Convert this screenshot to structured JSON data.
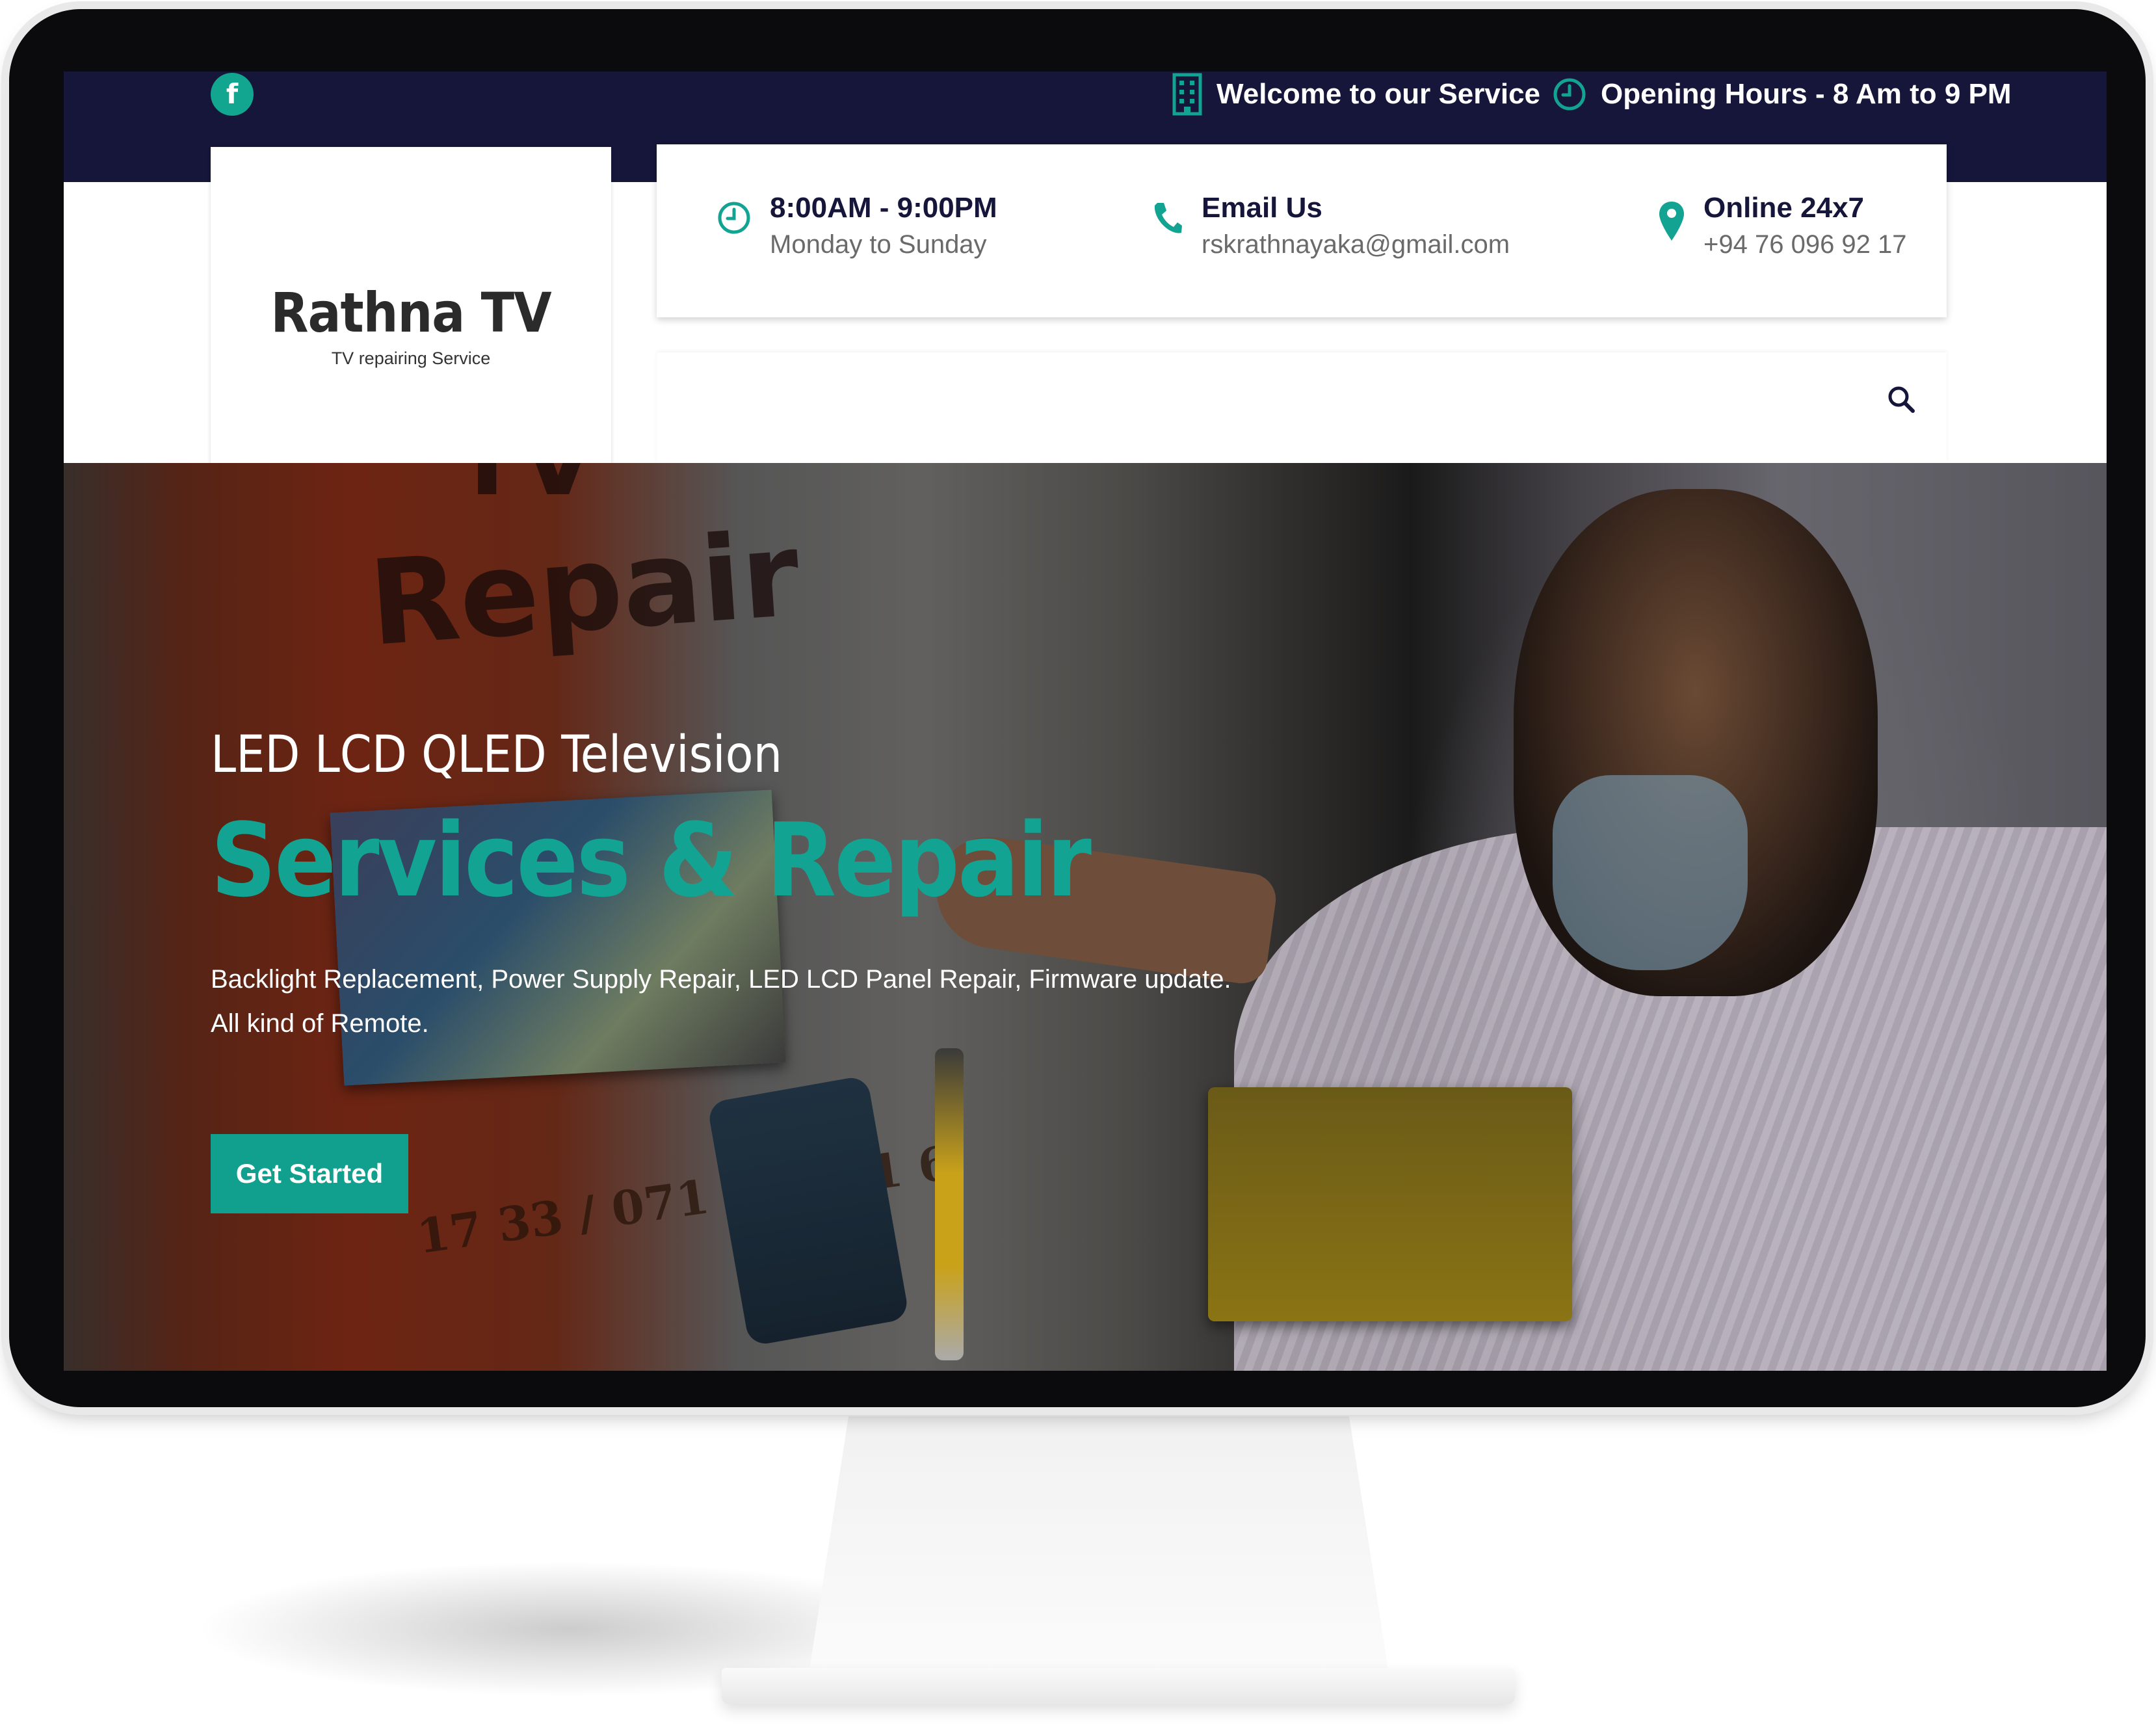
{
  "topbar": {
    "facebook_icon": "f",
    "welcome_text": "Welcome to our Service",
    "hours_text": "Opening Hours - 8 Am to 9 PM"
  },
  "brand": {
    "name": "Rathna TV",
    "tagline": "TV repairing Service"
  },
  "contact": [
    {
      "title": "8:00AM - 9:00PM",
      "text": "Monday to Sunday",
      "icon": "clock-icon"
    },
    {
      "title": "Email Us",
      "text": "rskrathnayaka@gmail.com",
      "icon": "phone-icon"
    },
    {
      "title": "Online 24x7",
      "text": "+94 76 096 92 17",
      "icon": "location-pin-icon"
    }
  ],
  "hero": {
    "kicker": "LED LCD QLED Television",
    "title": "Services & Repair",
    "description": "Backlight Replacement, Power Supply Repair, LED LCD Panel Repair, Firmware update. All kind of Remote.",
    "cta_label": "Get Started",
    "image_text": {
      "tv": "TV",
      "repair": "Repair",
      "phone": "17 33 / 071 729 51 6"
    }
  },
  "colors": {
    "accent": "#13a392",
    "navy": "#15163a",
    "white": "#ffffff"
  }
}
